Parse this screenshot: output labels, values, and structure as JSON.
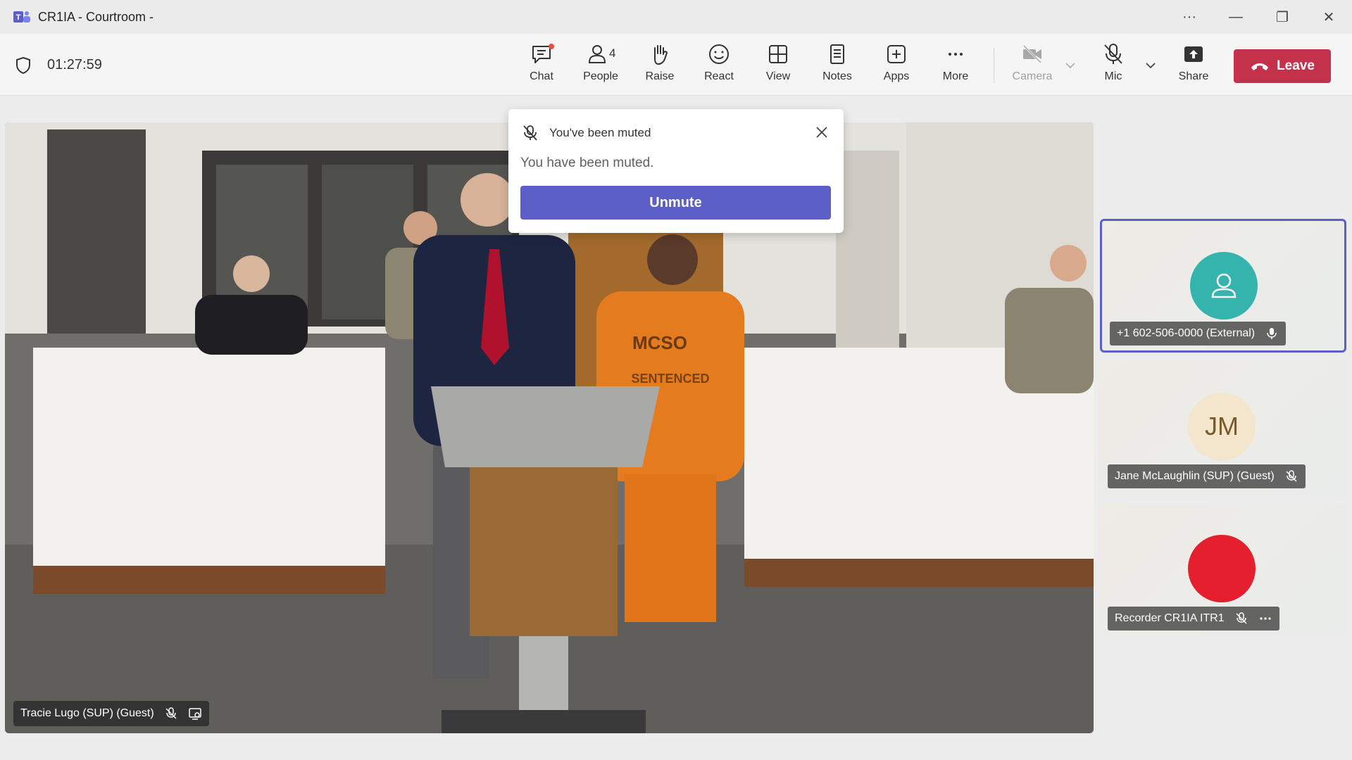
{
  "window": {
    "title": "CR1IA - Courtroom -",
    "controls": [
      "···",
      "—",
      "❐",
      "✕"
    ]
  },
  "meeting": {
    "timer": "01:27:59",
    "people_count": "4"
  },
  "toolbar": {
    "chat": "Chat",
    "people": "People",
    "raise": "Raise",
    "react": "React",
    "view": "View",
    "notes": "Notes",
    "apps": "Apps",
    "more": "More",
    "camera": "Camera",
    "mic": "Mic",
    "share": "Share",
    "leave": "Leave"
  },
  "toast": {
    "title": "You've been muted",
    "message": "You have been muted.",
    "action": "Unmute"
  },
  "stage": {
    "speaker_name": "Tracie Lugo (SUP) (Guest)",
    "shirt_text_1": "MCSO",
    "shirt_text_2": "SENTENCED"
  },
  "participants": [
    {
      "name": "+1 602-506-0000 (External)",
      "avatar_type": "person-icon",
      "color": "#35b3ad"
    },
    {
      "name": "Jane McLaughlin (SUP) (Guest)",
      "initials": "JM",
      "color": "#f3e6cc"
    },
    {
      "name": "Recorder CR1IA ITR1",
      "avatar_type": "record-dot",
      "color": "#e5202e"
    }
  ],
  "colors": {
    "brand": "#5b5fc7",
    "leave": "#c4314b"
  }
}
